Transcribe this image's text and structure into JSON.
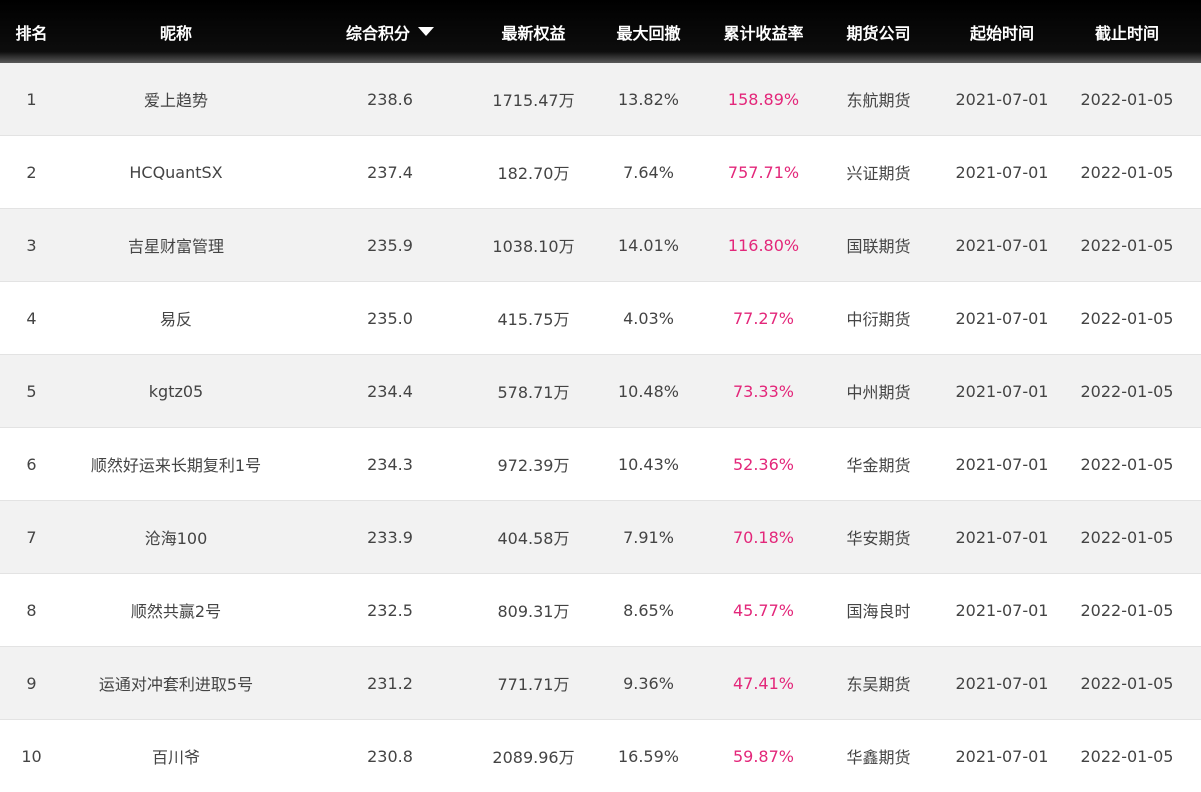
{
  "headers": {
    "rank": "排名",
    "nickname": "昵称",
    "score": "综合积分",
    "equity": "最新权益",
    "drawdown": "最大回撤",
    "return": "累计收益率",
    "company": "期货公司",
    "start": "起始时间",
    "end": "截止时间"
  },
  "sort": {
    "column": "score",
    "direction": "descending",
    "icon": "sort-down-icon"
  },
  "colors": {
    "header_bg": "#000000",
    "return_text": "#e3277a",
    "row_alt": "#f2f2f2"
  },
  "rows": [
    {
      "rank": "1",
      "name": "爱上趋势",
      "score": "238.6",
      "equity": "1715.47万",
      "drawdown": "13.82%",
      "ret": "158.89%",
      "company": "东航期货",
      "start": "2021-07-01",
      "end": "2022-01-05"
    },
    {
      "rank": "2",
      "name": "HCQuantSX",
      "score": "237.4",
      "equity": "182.70万",
      "drawdown": "7.64%",
      "ret": "757.71%",
      "company": "兴证期货",
      "start": "2021-07-01",
      "end": "2022-01-05"
    },
    {
      "rank": "3",
      "name": "吉星财富管理",
      "score": "235.9",
      "equity": "1038.10万",
      "drawdown": "14.01%",
      "ret": "116.80%",
      "company": "国联期货",
      "start": "2021-07-01",
      "end": "2022-01-05"
    },
    {
      "rank": "4",
      "name": "易反",
      "score": "235.0",
      "equity": "415.75万",
      "drawdown": "4.03%",
      "ret": "77.27%",
      "company": "中衍期货",
      "start": "2021-07-01",
      "end": "2022-01-05"
    },
    {
      "rank": "5",
      "name": "kgtz05",
      "score": "234.4",
      "equity": "578.71万",
      "drawdown": "10.48%",
      "ret": "73.33%",
      "company": "中州期货",
      "start": "2021-07-01",
      "end": "2022-01-05"
    },
    {
      "rank": "6",
      "name": "顺然好运来长期复利1号",
      "score": "234.3",
      "equity": "972.39万",
      "drawdown": "10.43%",
      "ret": "52.36%",
      "company": "华金期货",
      "start": "2021-07-01",
      "end": "2022-01-05"
    },
    {
      "rank": "7",
      "name": "沧海100",
      "score": "233.9",
      "equity": "404.58万",
      "drawdown": "7.91%",
      "ret": "70.18%",
      "company": "华安期货",
      "start": "2021-07-01",
      "end": "2022-01-05"
    },
    {
      "rank": "8",
      "name": "顺然共赢2号",
      "score": "232.5",
      "equity": "809.31万",
      "drawdown": "8.65%",
      "ret": "45.77%",
      "company": "国海良时",
      "start": "2021-07-01",
      "end": "2022-01-05"
    },
    {
      "rank": "9",
      "name": "运通对冲套利进取5号",
      "score": "231.2",
      "equity": "771.71万",
      "drawdown": "9.36%",
      "ret": "47.41%",
      "company": "东吴期货",
      "start": "2021-07-01",
      "end": "2022-01-05"
    },
    {
      "rank": "10",
      "name": "百川爷",
      "score": "230.8",
      "equity": "2089.96万",
      "drawdown": "16.59%",
      "ret": "59.87%",
      "company": "华鑫期货",
      "start": "2021-07-01",
      "end": "2022-01-05"
    }
  ]
}
